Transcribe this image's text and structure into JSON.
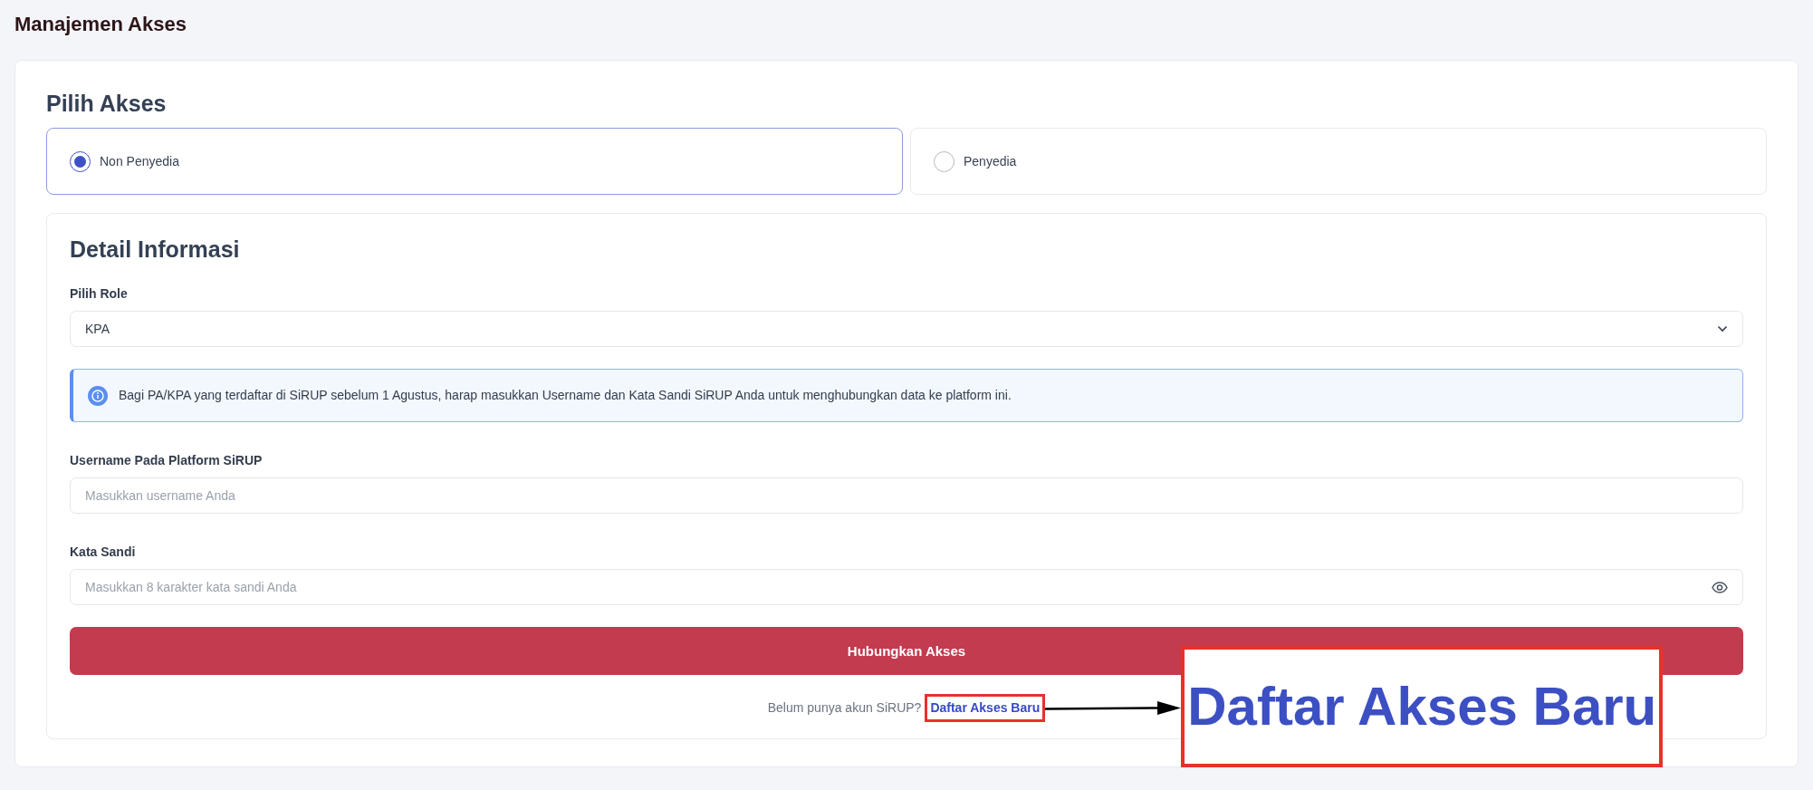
{
  "page": {
    "title": "Manajemen Akses"
  },
  "access": {
    "title": "Pilih Akses",
    "options": [
      {
        "label": "Non Penyedia",
        "selected": true
      },
      {
        "label": "Penyedia",
        "selected": false
      }
    ]
  },
  "detail": {
    "title": "Detail Informasi",
    "role": {
      "label": "Pilih Role",
      "value": "KPA"
    },
    "alert": {
      "text": "Bagi PA/KPA yang terdaftar di SiRUP sebelum 1 Agustus, harap masukkan Username dan Kata Sandi SiRUP Anda untuk menghubungkan data ke platform ini."
    },
    "username": {
      "label": "Username Pada Platform SiRUP",
      "placeholder": "Masukkan username Anda"
    },
    "password": {
      "label": "Kata Sandi",
      "placeholder": "Masukkan 8 karakter kata sandi Anda"
    },
    "submit": "Hubungkan Akses",
    "footer": {
      "text": "Belum punya akun SiRUP?",
      "link": "Daftar Akses Baru"
    }
  },
  "annotation": {
    "callout_text": "Daftar Akses Baru"
  }
}
